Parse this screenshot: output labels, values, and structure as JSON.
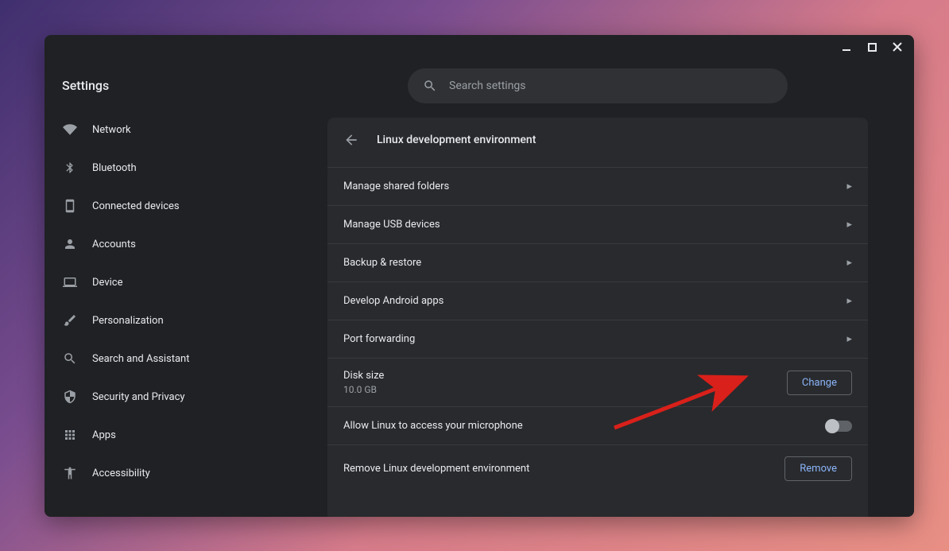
{
  "window": {
    "app_title": "Settings"
  },
  "search": {
    "placeholder": "Search settings"
  },
  "sidebar": {
    "items": [
      {
        "label": "Network",
        "icon": "wifi"
      },
      {
        "label": "Bluetooth",
        "icon": "bluetooth"
      },
      {
        "label": "Connected devices",
        "icon": "devices"
      },
      {
        "label": "Accounts",
        "icon": "person"
      },
      {
        "label": "Device",
        "icon": "laptop"
      },
      {
        "label": "Personalization",
        "icon": "brush"
      },
      {
        "label": "Search and Assistant",
        "icon": "search"
      },
      {
        "label": "Security and Privacy",
        "icon": "shield"
      },
      {
        "label": "Apps",
        "icon": "apps"
      },
      {
        "label": "Accessibility",
        "icon": "accessibility"
      }
    ]
  },
  "panel": {
    "title": "Linux development environment",
    "rows": {
      "shared": "Manage shared folders",
      "usb": "Manage USB devices",
      "backup": "Backup & restore",
      "android": "Develop Android apps",
      "port": "Port forwarding",
      "disk_label": "Disk size",
      "disk_value": "10.0 GB",
      "disk_button": "Change",
      "mic": "Allow Linux to access your microphone",
      "remove_label": "Remove Linux development environment",
      "remove_button": "Remove"
    }
  },
  "colors": {
    "accent": "#8ab4f8",
    "panel_bg": "#292a2d",
    "window_bg": "#202124"
  }
}
